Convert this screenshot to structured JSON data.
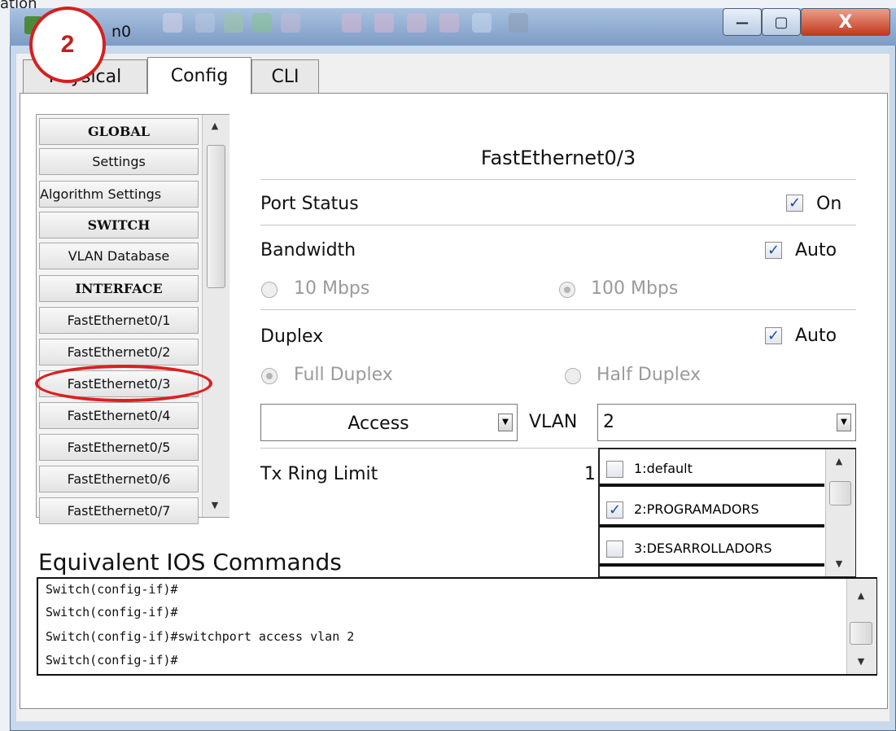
{
  "background_app": {
    "title_fragment": "ation"
  },
  "window": {
    "title": "n0",
    "minimize_label": "—",
    "maximize_label": "▢",
    "close_label": "X"
  },
  "tabs": [
    {
      "label": "Physical"
    },
    {
      "label": "Config"
    },
    {
      "label": "CLI"
    }
  ],
  "sidebar": {
    "items": [
      {
        "label": "GLOBAL"
      },
      {
        "label": "Settings"
      },
      {
        "label": "Algorithm Settings"
      },
      {
        "label": "SWITCH"
      },
      {
        "label": "VLAN Database"
      },
      {
        "label": "INTERFACE"
      },
      {
        "label": "FastEthernet0/1"
      },
      {
        "label": "FastEthernet0/2"
      },
      {
        "label": "FastEthernet0/3"
      },
      {
        "label": "FastEthernet0/4"
      },
      {
        "label": "FastEthernet0/5"
      },
      {
        "label": "FastEthernet0/6"
      },
      {
        "label": "FastEthernet0/7"
      }
    ]
  },
  "port": {
    "name": "FastEthernet0/3",
    "status_label": "Port Status",
    "status_value": "On",
    "bandwidth_label": "Bandwidth",
    "bandwidth_auto": "Auto",
    "bw_10": "10 Mbps",
    "bw_100": "100 Mbps",
    "duplex_label": "Duplex",
    "duplex_auto": "Auto",
    "full_duplex": "Full Duplex",
    "half_duplex": "Half Duplex",
    "mode": "Access",
    "vlan_label": "VLAN",
    "vlan_value": "2",
    "tx_label": "Tx Ring Limit",
    "tx_value": "1"
  },
  "vlan_options": [
    {
      "label": "1:default",
      "checked": false
    },
    {
      "label": "2:PROGRAMADORS",
      "checked": true
    },
    {
      "label": "3:DESARROLLADORS",
      "checked": false
    }
  ],
  "ios": {
    "title": "Equivalent IOS Commands",
    "lines": [
      "Switch(config-if)#",
      "Switch(config-if)#",
      "Switch(config-if)#switchport access vlan 2",
      "Switch(config-if)#"
    ]
  },
  "annotations": {
    "step_badge": "2"
  },
  "colors": {
    "annotation_red": "#d61f1f",
    "checkmark": "#1b4aa5"
  }
}
